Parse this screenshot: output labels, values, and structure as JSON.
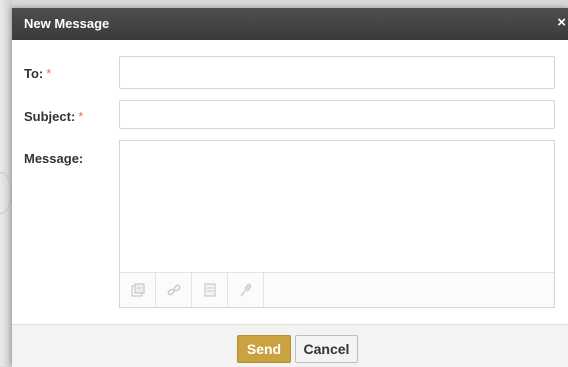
{
  "dialog": {
    "title": "New Message",
    "close_glyph": "×"
  },
  "form": {
    "to": {
      "label": "To:",
      "required_mark": "*",
      "value": ""
    },
    "subject": {
      "label": "Subject:",
      "required_mark": "*",
      "value": ""
    },
    "message": {
      "label": "Message:",
      "value": ""
    }
  },
  "toolbar": {
    "icons": [
      "attach-file-icon",
      "link-icon",
      "document-icon",
      "microphone-icon"
    ]
  },
  "actions": {
    "send_label": "Send",
    "cancel_label": "Cancel"
  },
  "colors": {
    "titlebar": "#3f3f3f",
    "send_button": "#caa23f",
    "required_mark": "#e07a4a"
  }
}
